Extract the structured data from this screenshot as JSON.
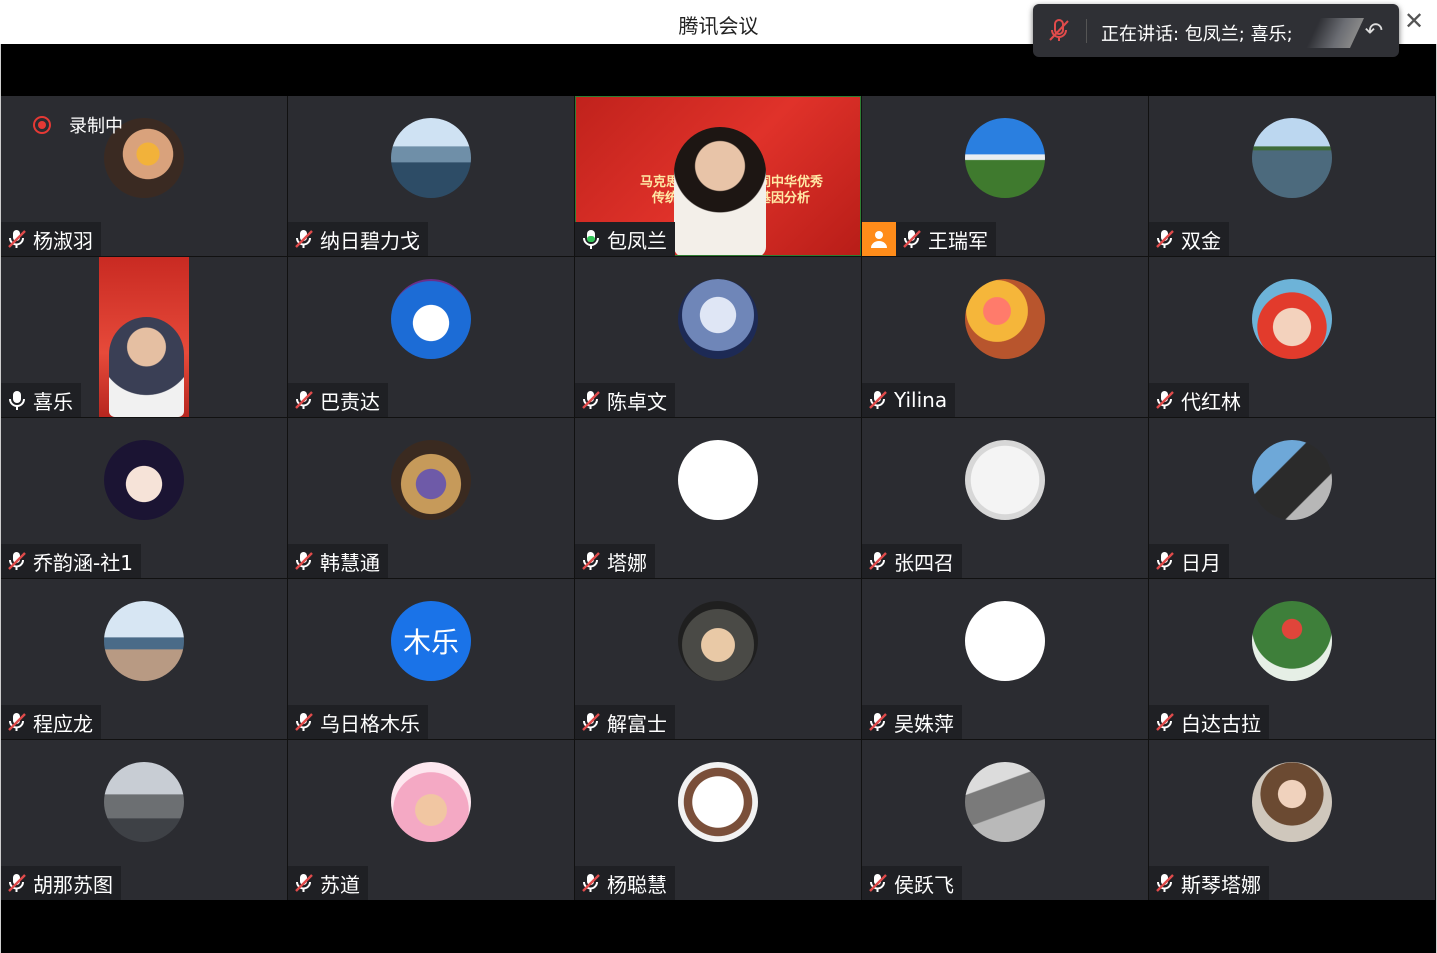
{
  "window": {
    "title": "腾讯会议"
  },
  "speaking": {
    "text": "正在讲话: 包凤兰; 喜乐;"
  },
  "recording": {
    "label": "录制中"
  },
  "main_video": {
    "line1": "马克思主",
    "line2": "传统文",
    "line3": "同中华优秀",
    "line4": "基因分析"
  },
  "participants": [
    {
      "name": "杨淑羽",
      "mic": "muted",
      "avatar": "hand-photo"
    },
    {
      "name": "纳日碧力戈",
      "mic": "muted",
      "avatar": "lake-photo"
    },
    {
      "name": "包凤兰",
      "mic": "speaking",
      "avatar": "video"
    },
    {
      "name": "王瑞军",
      "mic": "muted",
      "avatar": "field-photo",
      "badge": "person-icon"
    },
    {
      "name": "双金",
      "mic": "muted",
      "avatar": "sea-photo"
    },
    {
      "name": "喜乐",
      "mic": "on",
      "avatar": "video-small"
    },
    {
      "name": "巴责达",
      "mic": "muted",
      "avatar": "doraemon"
    },
    {
      "name": "陈卓文",
      "mic": "muted",
      "avatar": "anime-boy"
    },
    {
      "name": "Yilina",
      "mic": "muted",
      "avatar": "flowers"
    },
    {
      "name": "代红林",
      "mic": "muted",
      "avatar": "child-hat"
    },
    {
      "name": "乔韵涵-社1",
      "mic": "muted",
      "avatar": "anime-girl"
    },
    {
      "name": "韩慧通",
      "mic": "muted",
      "avatar": "teletubby"
    },
    {
      "name": "塔娜",
      "mic": "muted",
      "avatar": "stick-figure"
    },
    {
      "name": "张四召",
      "mic": "muted",
      "avatar": "mother-child"
    },
    {
      "name": "日月",
      "mic": "muted",
      "avatar": "driving"
    },
    {
      "name": "程应龙",
      "mic": "muted",
      "avatar": "family"
    },
    {
      "name": "乌日格木乐",
      "mic": "muted",
      "avatar": "text",
      "avatar_text": "木乐"
    },
    {
      "name": "解富士",
      "mic": "muted",
      "avatar": "hood"
    },
    {
      "name": "吴姝萍",
      "mic": "muted",
      "avatar": "sketch"
    },
    {
      "name": "白达古拉",
      "mic": "muted",
      "avatar": "tulip"
    },
    {
      "name": "胡那苏图",
      "mic": "muted",
      "avatar": "town"
    },
    {
      "name": "苏道",
      "mic": "muted",
      "avatar": "kid-card"
    },
    {
      "name": "杨聪慧",
      "mic": "muted",
      "avatar": "girl-drawing"
    },
    {
      "name": "侯跃飞",
      "mic": "muted",
      "avatar": "snow-man"
    },
    {
      "name": "斯琴塔娜",
      "mic": "muted",
      "avatar": "girl-photo"
    }
  ],
  "colors": {
    "tile_bg": "#2b2c31",
    "accent_orange": "#ff8c1a",
    "record_red": "#e53935",
    "speaking_green": "#2e7d32"
  }
}
